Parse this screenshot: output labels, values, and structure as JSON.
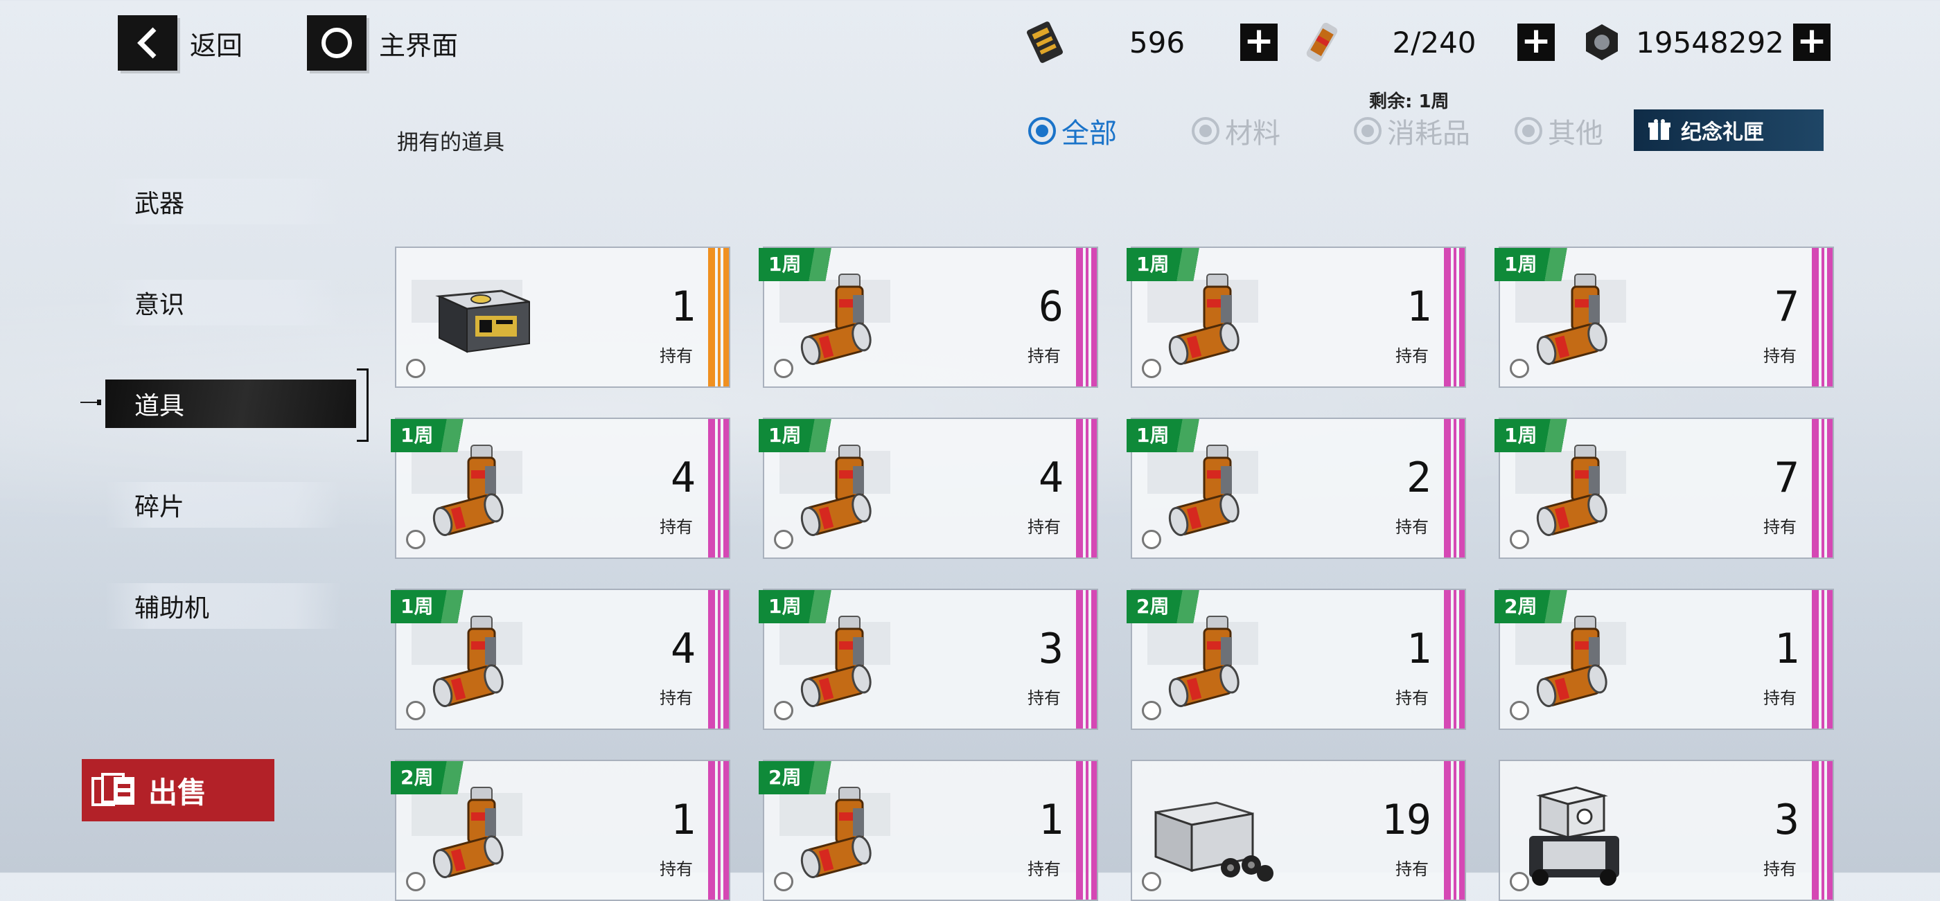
{
  "nav": {
    "back_label": "返回",
    "home_label": "主界面"
  },
  "resources": {
    "crystals": "596",
    "stamina": "2/240",
    "coins": "19548292"
  },
  "remaining": "剩余: 1周",
  "owned_title": "拥有的道具",
  "filters": {
    "all": "全部",
    "materials": "材料",
    "consumables": "消耗品",
    "other": "其他",
    "selected": "全部"
  },
  "gift_box": "纪念礼匣",
  "sidebar": {
    "items": [
      "武器",
      "意识",
      "道具",
      "碎片",
      "辅助机"
    ],
    "active": "道具"
  },
  "sell_label": "出售",
  "held_label": "持有",
  "colors": {
    "accent_blue": "#1a73c9",
    "tag_green": "#0f8a39",
    "stripe_pink": "#d548b4",
    "stripe_orange": "#f09020",
    "sell_red": "#b32128"
  },
  "cards": [
    {
      "count": "1",
      "tag": "",
      "rarity": "orange",
      "icon": "supply-crate-icon"
    },
    {
      "count": "6",
      "tag": "1周",
      "rarity": "pink",
      "icon": "stamina-canister-icon"
    },
    {
      "count": "1",
      "tag": "1周",
      "rarity": "pink",
      "icon": "stamina-canister-icon"
    },
    {
      "count": "7",
      "tag": "1周",
      "rarity": "pink",
      "icon": "stamina-canister-icon"
    },
    {
      "count": "4",
      "tag": "1周",
      "rarity": "pink",
      "icon": "stamina-canister-icon"
    },
    {
      "count": "4",
      "tag": "1周",
      "rarity": "pink",
      "icon": "stamina-canister-icon"
    },
    {
      "count": "2",
      "tag": "1周",
      "rarity": "pink",
      "icon": "stamina-canister-icon"
    },
    {
      "count": "7",
      "tag": "1周",
      "rarity": "pink",
      "icon": "stamina-canister-icon"
    },
    {
      "count": "4",
      "tag": "1周",
      "rarity": "pink",
      "icon": "stamina-canister-icon"
    },
    {
      "count": "3",
      "tag": "1周",
      "rarity": "pink",
      "icon": "stamina-canister-icon"
    },
    {
      "count": "1",
      "tag": "2周",
      "rarity": "pink",
      "icon": "stamina-canister-icon"
    },
    {
      "count": "1",
      "tag": "2周",
      "rarity": "pink",
      "icon": "stamina-canister-icon"
    },
    {
      "count": "1",
      "tag": "2周",
      "rarity": "pink",
      "icon": "stamina-canister-icon"
    },
    {
      "count": "1",
      "tag": "2周",
      "rarity": "pink",
      "icon": "stamina-canister-icon"
    },
    {
      "count": "19",
      "tag": "",
      "rarity": "pink",
      "icon": "metal-box-icon"
    },
    {
      "count": "3",
      "tag": "",
      "rarity": "pink",
      "icon": "machine-unit-icon"
    }
  ]
}
